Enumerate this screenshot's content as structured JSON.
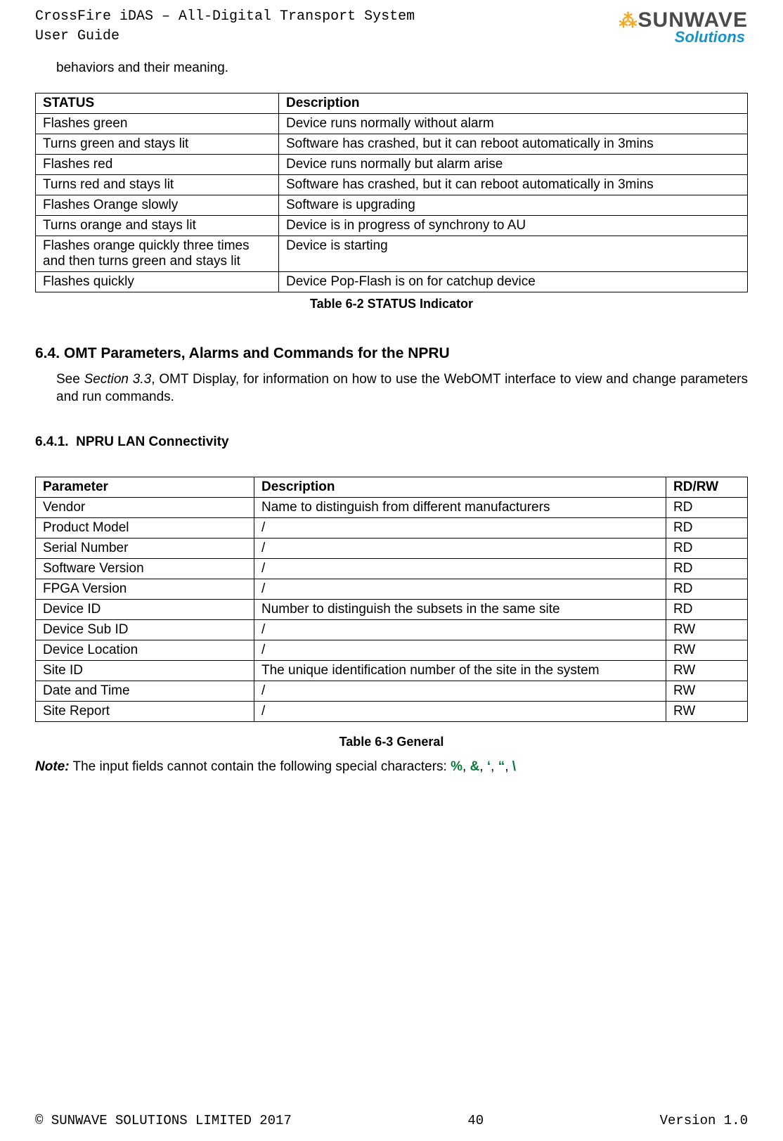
{
  "header": {
    "title_line1": "CrossFire iDAS – All-Digital Transport System",
    "title_line2": "User Guide",
    "logo_main_prefix": "SUNWAVE",
    "logo_sub": "Solutions"
  },
  "intro_fragment": "behaviors and their meaning.",
  "table1": {
    "headers": [
      "STATUS",
      "Description"
    ],
    "rows": [
      [
        "Flashes green",
        "Device runs normally without alarm"
      ],
      [
        "Turns green and stays lit",
        "Software has crashed, but it can reboot automatically in 3mins"
      ],
      [
        "Flashes red",
        "Device runs normally but alarm arise"
      ],
      [
        "Turns red and stays lit",
        "Software has crashed, but it can reboot automatically in 3mins"
      ],
      [
        "Flashes Orange slowly",
        "Software is upgrading"
      ],
      [
        "Turns orange and stays lit",
        "Device is in progress of synchrony to AU"
      ],
      [
        "Flashes orange quickly three times and then turns green and stays lit",
        "Device is starting"
      ],
      [
        "Flashes quickly",
        "Device Pop-Flash is on for catchup device"
      ]
    ],
    "caption": "Table 6-2 STATUS Indicator"
  },
  "section64": {
    "number": "6.4.",
    "title": "OMT Parameters, Alarms and Commands for the NPRU",
    "body_prefix": "See ",
    "body_italic": "Section 3.3",
    "body_suffix": ", OMT Display, for information on how to use the WebOMT interface to view and change parameters and run commands."
  },
  "section641": {
    "number": "6.4.1.",
    "title": "NPRU LAN Connectivity"
  },
  "table2": {
    "headers": [
      "Parameter",
      "Description",
      "RD/RW"
    ],
    "rows": [
      [
        "Vendor",
        "Name to distinguish from different manufacturers",
        "RD"
      ],
      [
        "Product Model",
        "/",
        "RD"
      ],
      [
        "Serial Number",
        "/",
        "RD"
      ],
      [
        "Software Version",
        "/",
        "RD"
      ],
      [
        "FPGA Version",
        "/",
        "RD"
      ],
      [
        "Device ID",
        "Number to distinguish the subsets in the same site",
        "RD"
      ],
      [
        "Device Sub ID",
        "/",
        "RW"
      ],
      [
        "Device Location",
        "/",
        "RW"
      ],
      [
        "Site ID",
        "The unique identification number of the site in the system",
        "RW"
      ],
      [
        "Date and Time",
        "/",
        "RW"
      ],
      [
        "Site Report",
        "/",
        "RW"
      ]
    ],
    "caption": "Table 6-3 General"
  },
  "note": {
    "label": "Note:",
    "text": " The input fields cannot contain the following special characters: ",
    "chars": [
      "%",
      "&",
      "‘",
      "“",
      "\\"
    ]
  },
  "footer": {
    "left": "© SUNWAVE SOLUTIONS LIMITED 2017",
    "center": "40",
    "right": "Version 1.0"
  }
}
